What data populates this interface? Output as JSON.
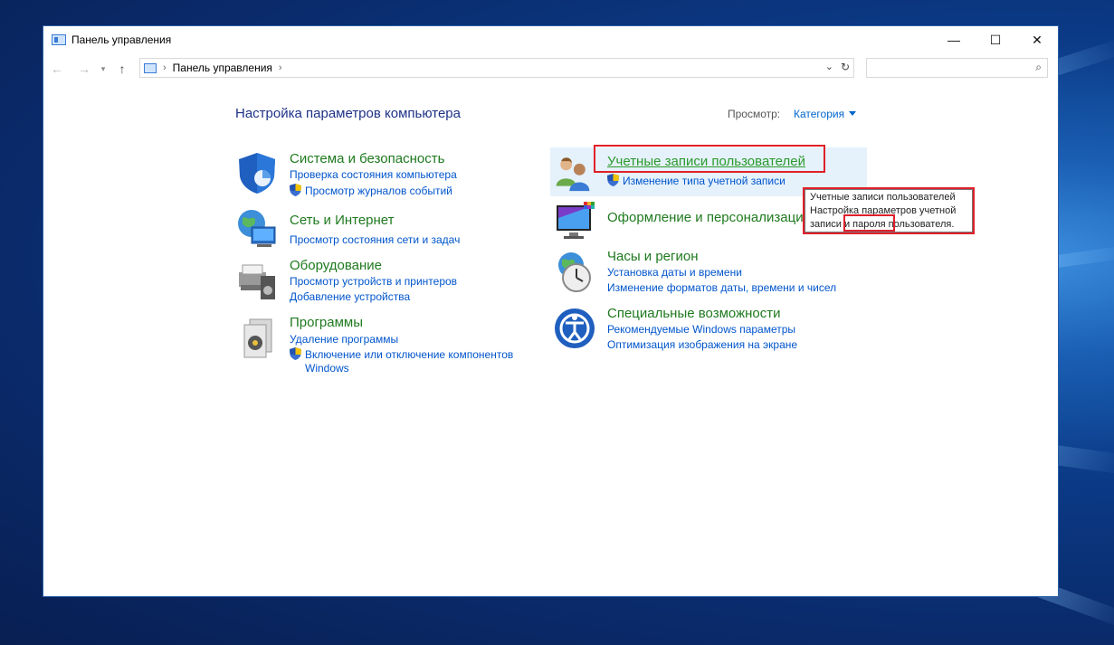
{
  "window": {
    "title": "Панель управления",
    "controls": {
      "minimize": "—",
      "maximize": "☐",
      "close": "✕"
    }
  },
  "navbar": {
    "back": "←",
    "forward": "→",
    "recent": "▾",
    "up": "↑",
    "breadcrumb": "Панель управления",
    "separator": "›",
    "dropdown": "⌄",
    "refresh": "↻",
    "search_icon": "⌕",
    "search_placeholder": ""
  },
  "main": {
    "heading": "Настройка параметров компьютера",
    "view_label": "Просмотр:",
    "view_value": "Категория"
  },
  "categories": {
    "system": {
      "title": "Система и безопасность",
      "links": [
        "Проверка состояния компьютера",
        "Просмотр журналов событий"
      ]
    },
    "network": {
      "title": "Сеть и Интернет",
      "links": [
        "Просмотр состояния сети и задач"
      ]
    },
    "hardware": {
      "title": "Оборудование",
      "links": [
        "Просмотр устройств и принтеров",
        "Добавление устройства"
      ]
    },
    "programs": {
      "title": "Программы",
      "links": [
        "Удаление программы",
        "Включение или отключение компонентов",
        "Windows"
      ]
    },
    "accounts": {
      "title": "Учетные записи пользователей",
      "links": [
        "Изменение типа учетной записи"
      ]
    },
    "appearance": {
      "title": "Оформление и персонализаци",
      "links": []
    },
    "clock": {
      "title": "Часы и регион",
      "links": [
        "Установка даты и времени",
        "Изменение форматов даты, времени и чисел"
      ]
    },
    "ease": {
      "title": "Специальные возможности",
      "links": [
        "Рекомендуемые Windows параметры",
        "Оптимизация изображения на экране"
      ]
    }
  },
  "tooltip": {
    "line1": "Учетные записи пользователей",
    "line2": "Настройка параметров учетной",
    "line3_pre": "записи ",
    "line3_hl": "и пароля",
    "line3_post": " пользователя."
  },
  "colors": {
    "category_title": "#1f7a1f",
    "link": "#0055cc",
    "heading": "#1e3287",
    "highlight": "#e0202a"
  }
}
